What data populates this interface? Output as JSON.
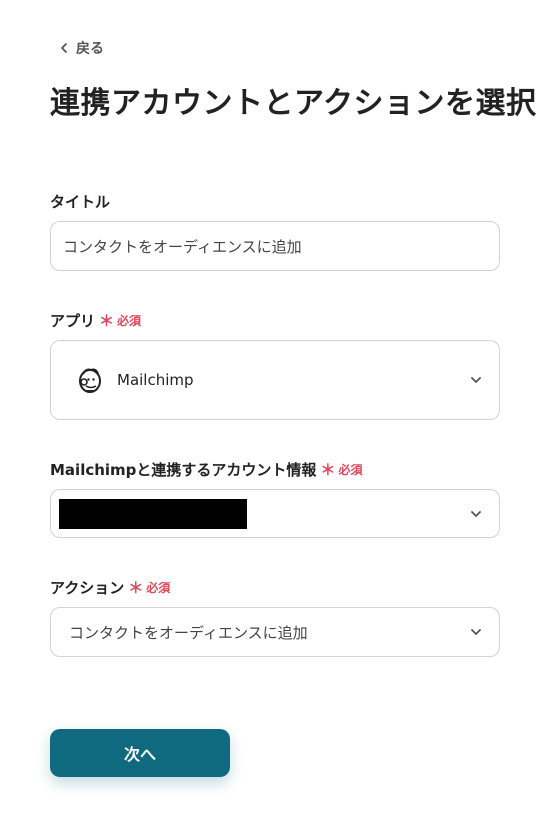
{
  "nav": {
    "back_label": "戻る"
  },
  "page": {
    "title": "連携アカウントとアクションを選択"
  },
  "form": {
    "title_field": {
      "label": "タイトル",
      "value": "コンタクトをオーディエンスに追加"
    },
    "app_field": {
      "label": "アプリ",
      "required_mark": "＊",
      "required_text": "必須",
      "selected_app": "Mailchimp",
      "icon": "mailchimp-logo"
    },
    "account_field": {
      "label": "Mailchimpと連携するアカウント情報",
      "required_mark": "＊",
      "required_text": "必須"
    },
    "action_field": {
      "label": "アクション",
      "required_mark": "＊",
      "required_text": "必須",
      "selected_action": "コンタクトをオーディエンスに追加"
    }
  },
  "buttons": {
    "next_label": "次へ"
  },
  "colors": {
    "primary": "#0f6a80",
    "required": "#e0475a",
    "border": "#d3d3d3",
    "text": "#222222"
  }
}
